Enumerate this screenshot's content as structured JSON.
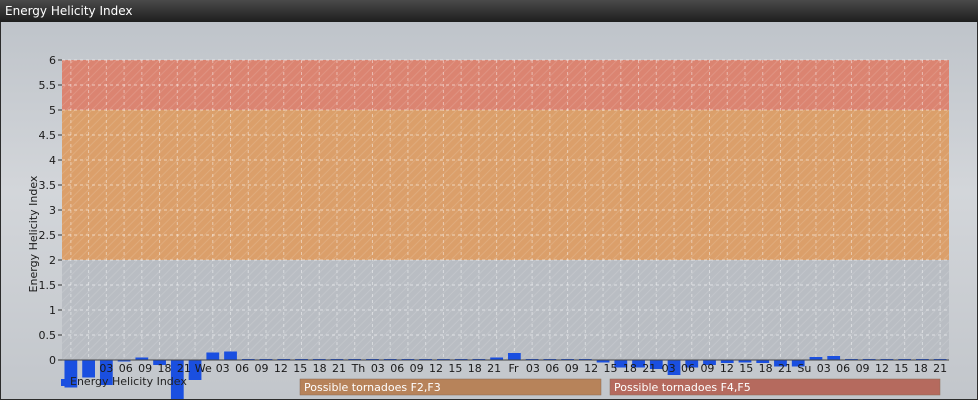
{
  "window": {
    "title": "Energy Helicity Index"
  },
  "chart_data": {
    "type": "bar",
    "ylabel": "Energy Helicity Index",
    "ylim": [
      0,
      6
    ],
    "yticks": [
      "0",
      "0.5",
      "1",
      "1.5",
      "2",
      "2.5",
      "3",
      "3.5",
      "4",
      "4.5",
      "5",
      "5.5",
      "6"
    ],
    "x_labels": [
      "03",
      "06",
      "09",
      "18",
      "21",
      "We",
      "03",
      "06",
      "09",
      "12",
      "15",
      "18",
      "21",
      "Th",
      "03",
      "06",
      "09",
      "12",
      "15",
      "18",
      "21",
      "Fr",
      "03",
      "06",
      "09",
      "12",
      "15",
      "18",
      "21",
      "03",
      "06",
      "09",
      "12",
      "15",
      "18",
      "21",
      "Su",
      "03",
      "06",
      "09",
      "12",
      "15",
      "18",
      "21"
    ],
    "series": [
      {
        "name": "Energy Helicity Index",
        "color": "#1a4fe0",
        "values": [
          -0.55,
          -0.35,
          -0.5,
          -0.03,
          0.05,
          -0.1,
          -0.8,
          -0.4,
          0.15,
          0.17,
          0.02,
          0.02,
          0.02,
          0.02,
          0.02,
          0.02,
          0.02,
          0.02,
          0.02,
          0.02,
          0.02,
          0.02,
          0.02,
          0.02,
          0.05,
          0.14,
          0.02,
          0.02,
          0.02,
          0.02,
          -0.05,
          -0.15,
          -0.15,
          -0.18,
          -0.3,
          -0.15,
          -0.1,
          -0.06,
          -0.05,
          -0.06,
          -0.13,
          -0.13,
          0.06,
          0.08,
          0.02,
          0.02,
          0.02,
          0.02,
          0.02,
          0.02
        ]
      }
    ],
    "bands": [
      {
        "from": 2,
        "to": 5,
        "color": "#e09a5a"
      },
      {
        "from": 5,
        "to": 6,
        "color": "#e07a63"
      }
    ],
    "band_labels": [
      {
        "text": "Possible tornadoes F2,F3",
        "color": "#b7835a"
      },
      {
        "text": "Possible tornadoes F4,F5",
        "color": "#b56a5e"
      }
    ],
    "legend": {
      "label": "Energy Helicity Index",
      "position": "bottom-left"
    },
    "grid": true
  }
}
